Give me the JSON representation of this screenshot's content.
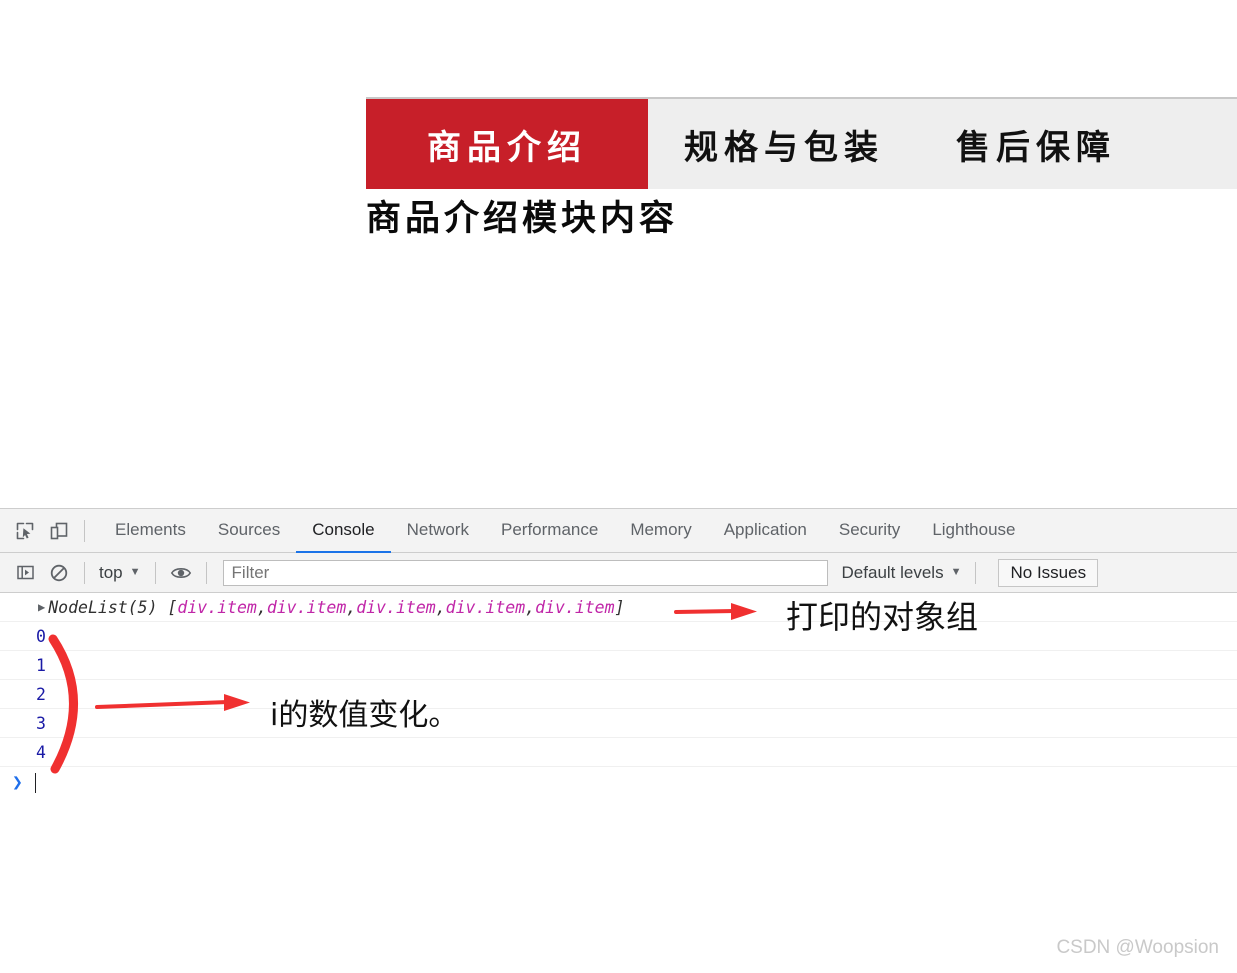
{
  "page": {
    "tabs": [
      {
        "label": "商品介绍",
        "active": true
      },
      {
        "label": "规格与包装",
        "active": false
      },
      {
        "label": "售后保障",
        "active": false
      }
    ],
    "module_title": "商品介绍模块内容",
    "accent_color": "#c71f29",
    "tabbar_bg": "#eeeeee"
  },
  "devtools": {
    "icons": {
      "inspect": "inspect-element-icon",
      "device": "device-toolbar-icon",
      "sidebar": "console-sidebar-icon",
      "clear": "clear-console-icon",
      "eye": "live-expression-icon"
    },
    "tabs": [
      {
        "label": "Elements",
        "selected": false
      },
      {
        "label": "Sources",
        "selected": false
      },
      {
        "label": "Console",
        "selected": true
      },
      {
        "label": "Network",
        "selected": false
      },
      {
        "label": "Performance",
        "selected": false
      },
      {
        "label": "Memory",
        "selected": false
      },
      {
        "label": "Application",
        "selected": false
      },
      {
        "label": "Security",
        "selected": false
      },
      {
        "label": "Lighthouse",
        "selected": false
      }
    ],
    "selected_tab_underline": "#1a73e8",
    "console_toolbar": {
      "context": "top",
      "filter_placeholder": "Filter",
      "filter_value": "",
      "levels": "Default levels",
      "issues": "No Issues"
    },
    "console": {
      "output_line": {
        "disclosure": "▶",
        "type_label": "NodeList(5)",
        "open_bracket": "[",
        "items": [
          "div.item",
          "div.item",
          "div.item",
          "div.item",
          "div.item"
        ],
        "separator": ", ",
        "close_bracket": "]",
        "node_color": "#c026a8"
      },
      "index_rows": [
        "0",
        "1",
        "2",
        "3",
        "4"
      ],
      "index_color": "#1a1aa6",
      "prompt": "❯"
    }
  },
  "annotations": {
    "arrow_color": "#f03030",
    "object_group_label": "打印的对象组",
    "i_value_label": "i的数值变化。"
  },
  "watermark": "CSDN @Woopsion"
}
